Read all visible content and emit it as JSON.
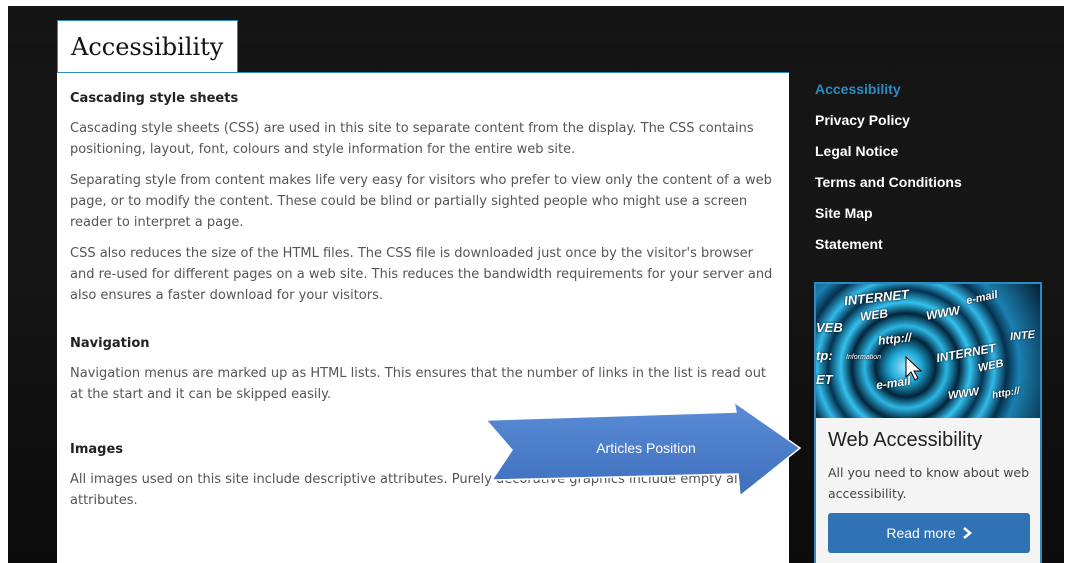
{
  "page": {
    "title": "Accessibility"
  },
  "main": {
    "sections": [
      {
        "heading": "Cascading style sheets",
        "paragraphs": [
          "Cascading style sheets (CSS) are used in this site to separate content from the display. The CSS contains positioning, layout, font, colours and style information for the entire web site.",
          "Separating style from content makes life very easy for visitors who prefer to view only the content of a web page, or to modify the content. These could be blind or partially sighted people who might use a screen reader to interpret a page.",
          "CSS also reduces the size of the HTML files. The CSS file is downloaded just once by the visitor's browser and re-used for different pages on a web site. This reduces the bandwidth requirements for your server and also ensures a faster download for your visitors."
        ]
      },
      {
        "heading": "Navigation",
        "paragraphs": [
          "Navigation menus are marked up as HTML lists. This ensures that the number of links in the list is read out at the start and it can be skipped easily."
        ]
      },
      {
        "heading": "Images",
        "paragraphs": [
          "All images used on this site include descriptive attributes. Purely decorative graphics include empty alt attributes."
        ]
      }
    ]
  },
  "sidebar": {
    "links": [
      {
        "label": "Accessibility",
        "active": true
      },
      {
        "label": "Privacy Policy",
        "active": false
      },
      {
        "label": "Legal Notice",
        "active": false
      },
      {
        "label": "Terms and Conditions",
        "active": false
      },
      {
        "label": "Site Map",
        "active": false
      },
      {
        "label": "Statement",
        "active": false
      }
    ]
  },
  "card": {
    "image_words": [
      "INTERNET",
      "e-mail",
      "WEB",
      "WWW",
      "http://",
      "INTERNET",
      "e-mail",
      "WEB",
      "WWW",
      "http://",
      "INTE",
      "tp:",
      "ET",
      "VEB",
      "Information"
    ],
    "title": "Web Accessibility",
    "description": "All you need to know about web accessibility.",
    "button_label": "Read more",
    "button_icon": "chevron-right-icon"
  },
  "annotation": {
    "label": "Articles Position"
  },
  "colors": {
    "accent": "#2b8cc4",
    "button": "#2f73b4",
    "callout": "#4a7bc8",
    "background": "#151515"
  }
}
